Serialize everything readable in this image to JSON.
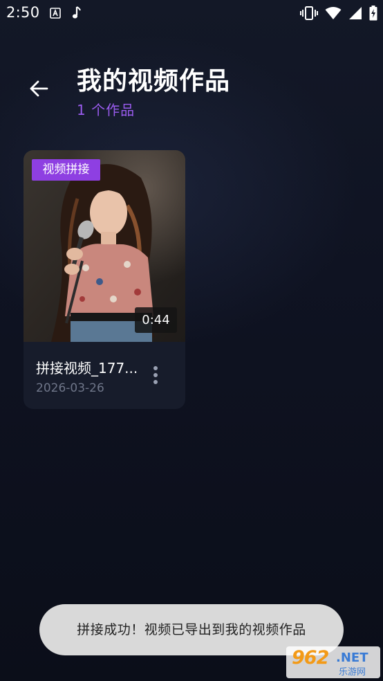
{
  "status_bar": {
    "time": "2:50",
    "left_icons": [
      "text-a-icon",
      "music-note-icon"
    ],
    "right_icons": [
      "vibrate-icon",
      "wifi-icon",
      "signal-icon",
      "battery-charging-icon"
    ]
  },
  "header": {
    "back_icon": "arrow-left-icon",
    "title": "我的视频作品",
    "count_text": "1 个作品"
  },
  "videos": [
    {
      "tag": "视频拼接",
      "duration": "0:44",
      "name": "拼接视频_177...",
      "date": "2026-03-26",
      "more_icon": "more-vertical-icon"
    }
  ],
  "toast": {
    "message": "拼接成功！视频已导出到我的视频作品"
  },
  "watermark": {
    "number": "962",
    "suffix": ".NET",
    "subtitle": "乐游网"
  },
  "colors": {
    "background": "#0e1220",
    "accent": "#9b5cf0",
    "tag": "#8e3fe2",
    "card": "#171c2b",
    "toast": "#d9d9d9"
  }
}
